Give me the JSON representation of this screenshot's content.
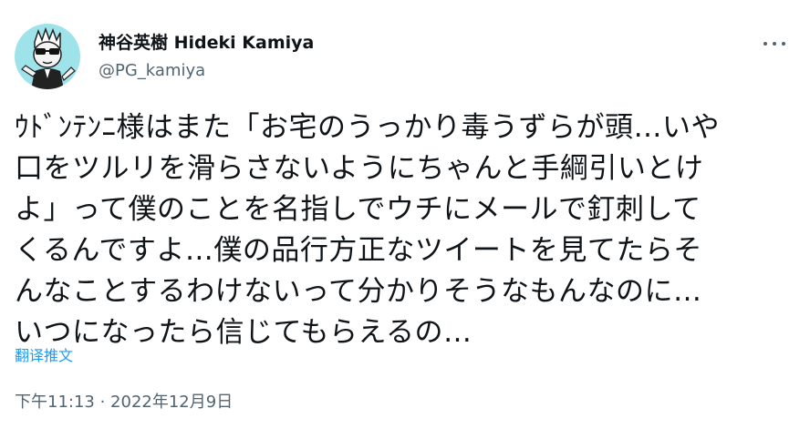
{
  "author": {
    "display_name": "神谷英樹 Hideki Kamiya",
    "handle": "@PG_kamiya"
  },
  "tweet": {
    "lines": [
      "ｳﾄﾞﾝﾃﾝﾆ様はまた「お宅のうっかり毒うずらが頭…いや",
      "口をツルリを滑らさないようにちゃんと手綱引いとけ",
      "よ」って僕のことを名指しでウチにメールで釘刺して",
      "くるんですよ…僕の品行方正なツイートを見てたらそ",
      "んなことするわけないって分かりそうなもんなのに…",
      "いつになったら信じてもらえるの…"
    ],
    "translate_label": "翻译推文",
    "timestamp": "下午11:13 · 2022年12月9日"
  },
  "icons": {
    "more": "more-horizontal-icon",
    "avatar": "cartoon-avatar"
  },
  "colors": {
    "text": "#0f1419",
    "secondary": "#536471",
    "link": "#1d9bf0",
    "avatar_bg": "#9ee3ea"
  }
}
